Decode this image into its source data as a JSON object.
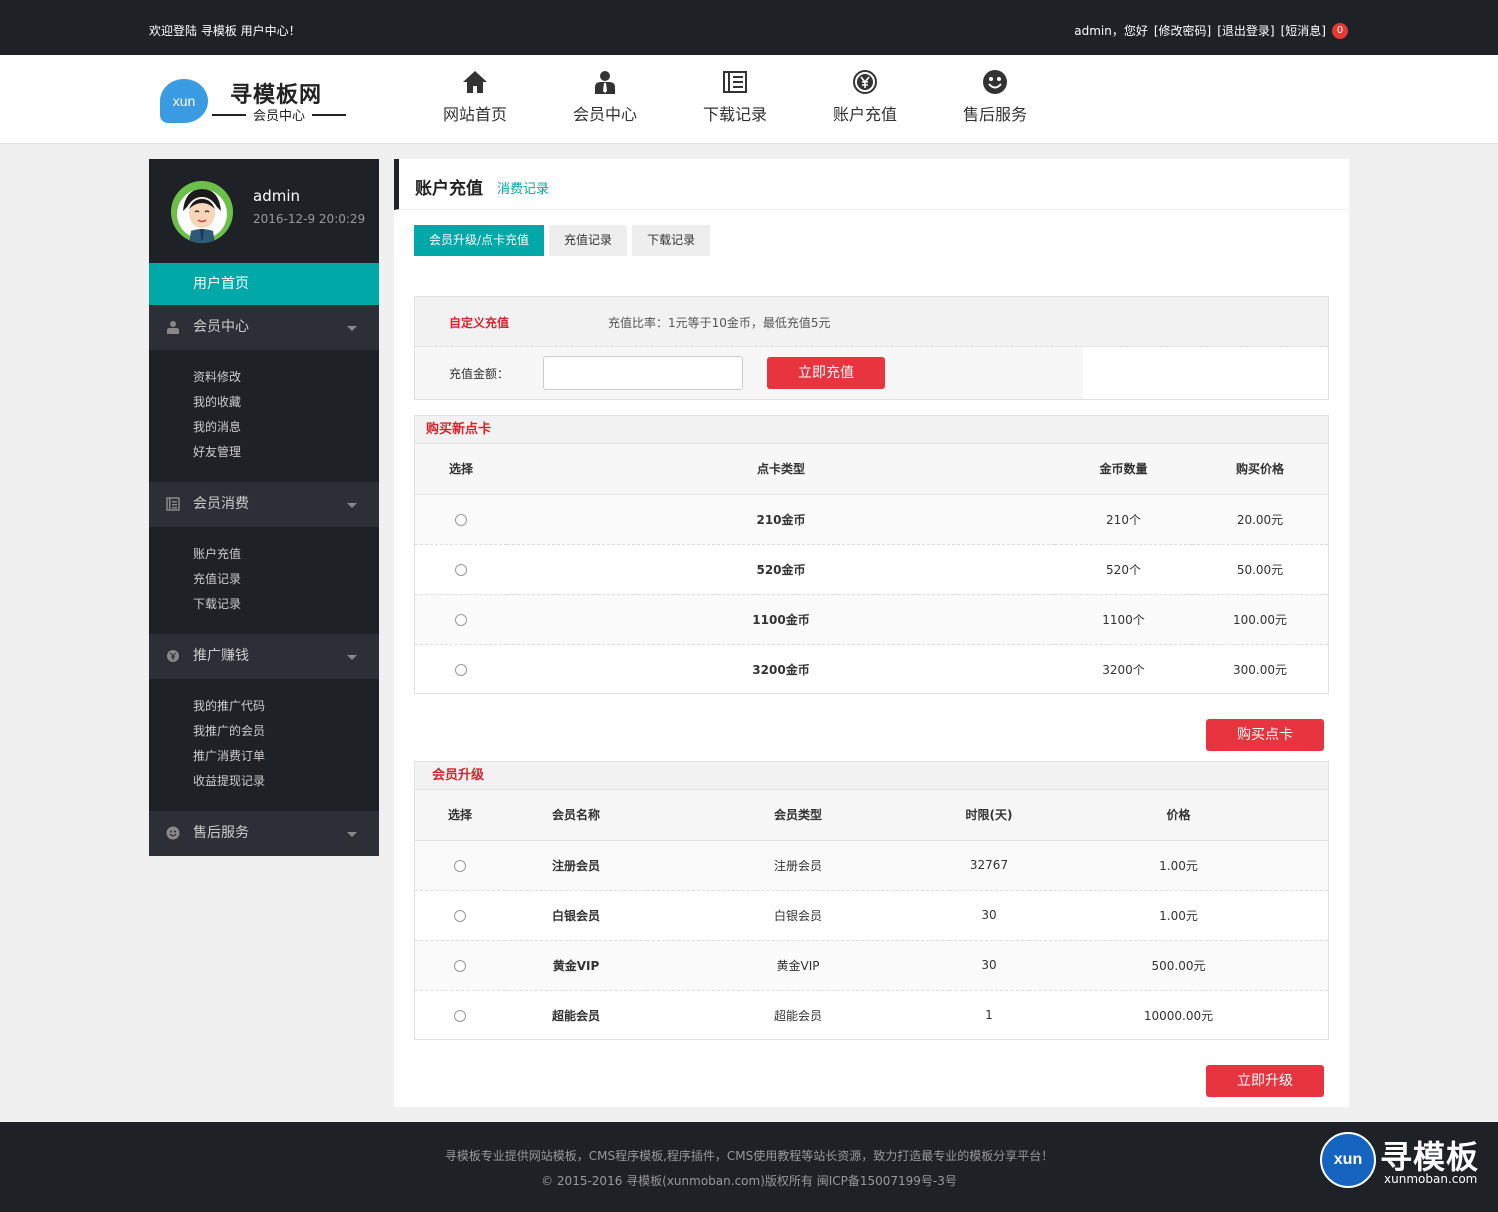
{
  "topbar": {
    "welcome": "欢迎登陆 寻模板 用户中心！",
    "greeting": "admin，您好",
    "change_password": "[修改密码]",
    "logout": "[退出登录]",
    "messages": "[短消息]",
    "message_count": "0"
  },
  "header": {
    "logo_badge": "xun",
    "logo_title": "寻模板网",
    "logo_sub": "会员中心",
    "nav": [
      {
        "label": "网站首页",
        "icon": "home-icon"
      },
      {
        "label": "会员中心",
        "icon": "user-icon"
      },
      {
        "label": "下载记录",
        "icon": "document-icon"
      },
      {
        "label": "账户充值",
        "icon": "yen-icon"
      },
      {
        "label": "售后服务",
        "icon": "smile-icon"
      }
    ]
  },
  "sidebar": {
    "username": "admin",
    "login_time": "2016-12-9 20:0:29",
    "home": "用户首页",
    "groups": [
      {
        "title": "会员中心",
        "icon": "user-icon",
        "links": [
          "资料修改",
          "我的收藏",
          "我的消息",
          "好友管理"
        ]
      },
      {
        "title": "会员消费",
        "icon": "document-icon",
        "links": [
          "账户充值",
          "充值记录",
          "下载记录"
        ]
      },
      {
        "title": "推广赚钱",
        "icon": "yen-icon",
        "links": [
          "我的推广代码",
          "我推广的会员",
          "推广消费订单",
          "收益提现记录"
        ]
      },
      {
        "title": "售后服务",
        "icon": "smile-icon",
        "links": []
      }
    ]
  },
  "content": {
    "title": "账户充值",
    "sublink": "消费记录",
    "tabs": [
      "会员升级/点卡充值",
      "充值记录",
      "下载记录"
    ],
    "custom": {
      "label": "自定义充值",
      "ratio": "充值比率：1元等于10金币，最低充值5元",
      "amount_label": "充值金额：",
      "amount_value": "",
      "submit": "立即充值"
    },
    "cards": {
      "title": "购买新点卡",
      "headers": [
        "选择",
        "点卡类型",
        "金币数量",
        "购买价格"
      ],
      "rows": [
        {
          "type": "210金币",
          "coins": "210个",
          "price": "20.00元"
        },
        {
          "type": "520金币",
          "coins": "520个",
          "price": "50.00元"
        },
        {
          "type": "1100金币",
          "coins": "1100个",
          "price": "100.00元"
        },
        {
          "type": "3200金币",
          "coins": "3200个",
          "price": "300.00元"
        }
      ],
      "button": "购买点卡"
    },
    "upgrade": {
      "title": "会员升级",
      "headers": [
        "选择",
        "会员名称",
        "会员类型",
        "时限(天)",
        "价格"
      ],
      "rows": [
        {
          "name": "注册会员",
          "type": "注册会员",
          "days": "32767",
          "price": "1.00元"
        },
        {
          "name": "白银会员",
          "type": "白银会员",
          "days": "30",
          "price": "1.00元"
        },
        {
          "name": "黄金VIP",
          "type": "黄金VIP",
          "days": "30",
          "price": "500.00元"
        },
        {
          "name": "超能会员",
          "type": "超能会员",
          "days": "1",
          "price": "10000.00元"
        }
      ],
      "button": "立即升级"
    }
  },
  "footer": {
    "line1": "寻模板专业提供网站模板，CMS程序模板,程序插件，CMS使用教程等站长资源，致力打造最专业的模板分享平台！",
    "line2": "© 2015-2016 寻模板(xunmoban.com)版权所有   闽ICP备15007199号-3号",
    "corner_badge": "xun",
    "corner_title": "寻模板",
    "corner_url": "xunmoban.com"
  },
  "colors": {
    "accent": "#00a8a8",
    "danger": "#e8343e",
    "dark": "#1e2227"
  }
}
